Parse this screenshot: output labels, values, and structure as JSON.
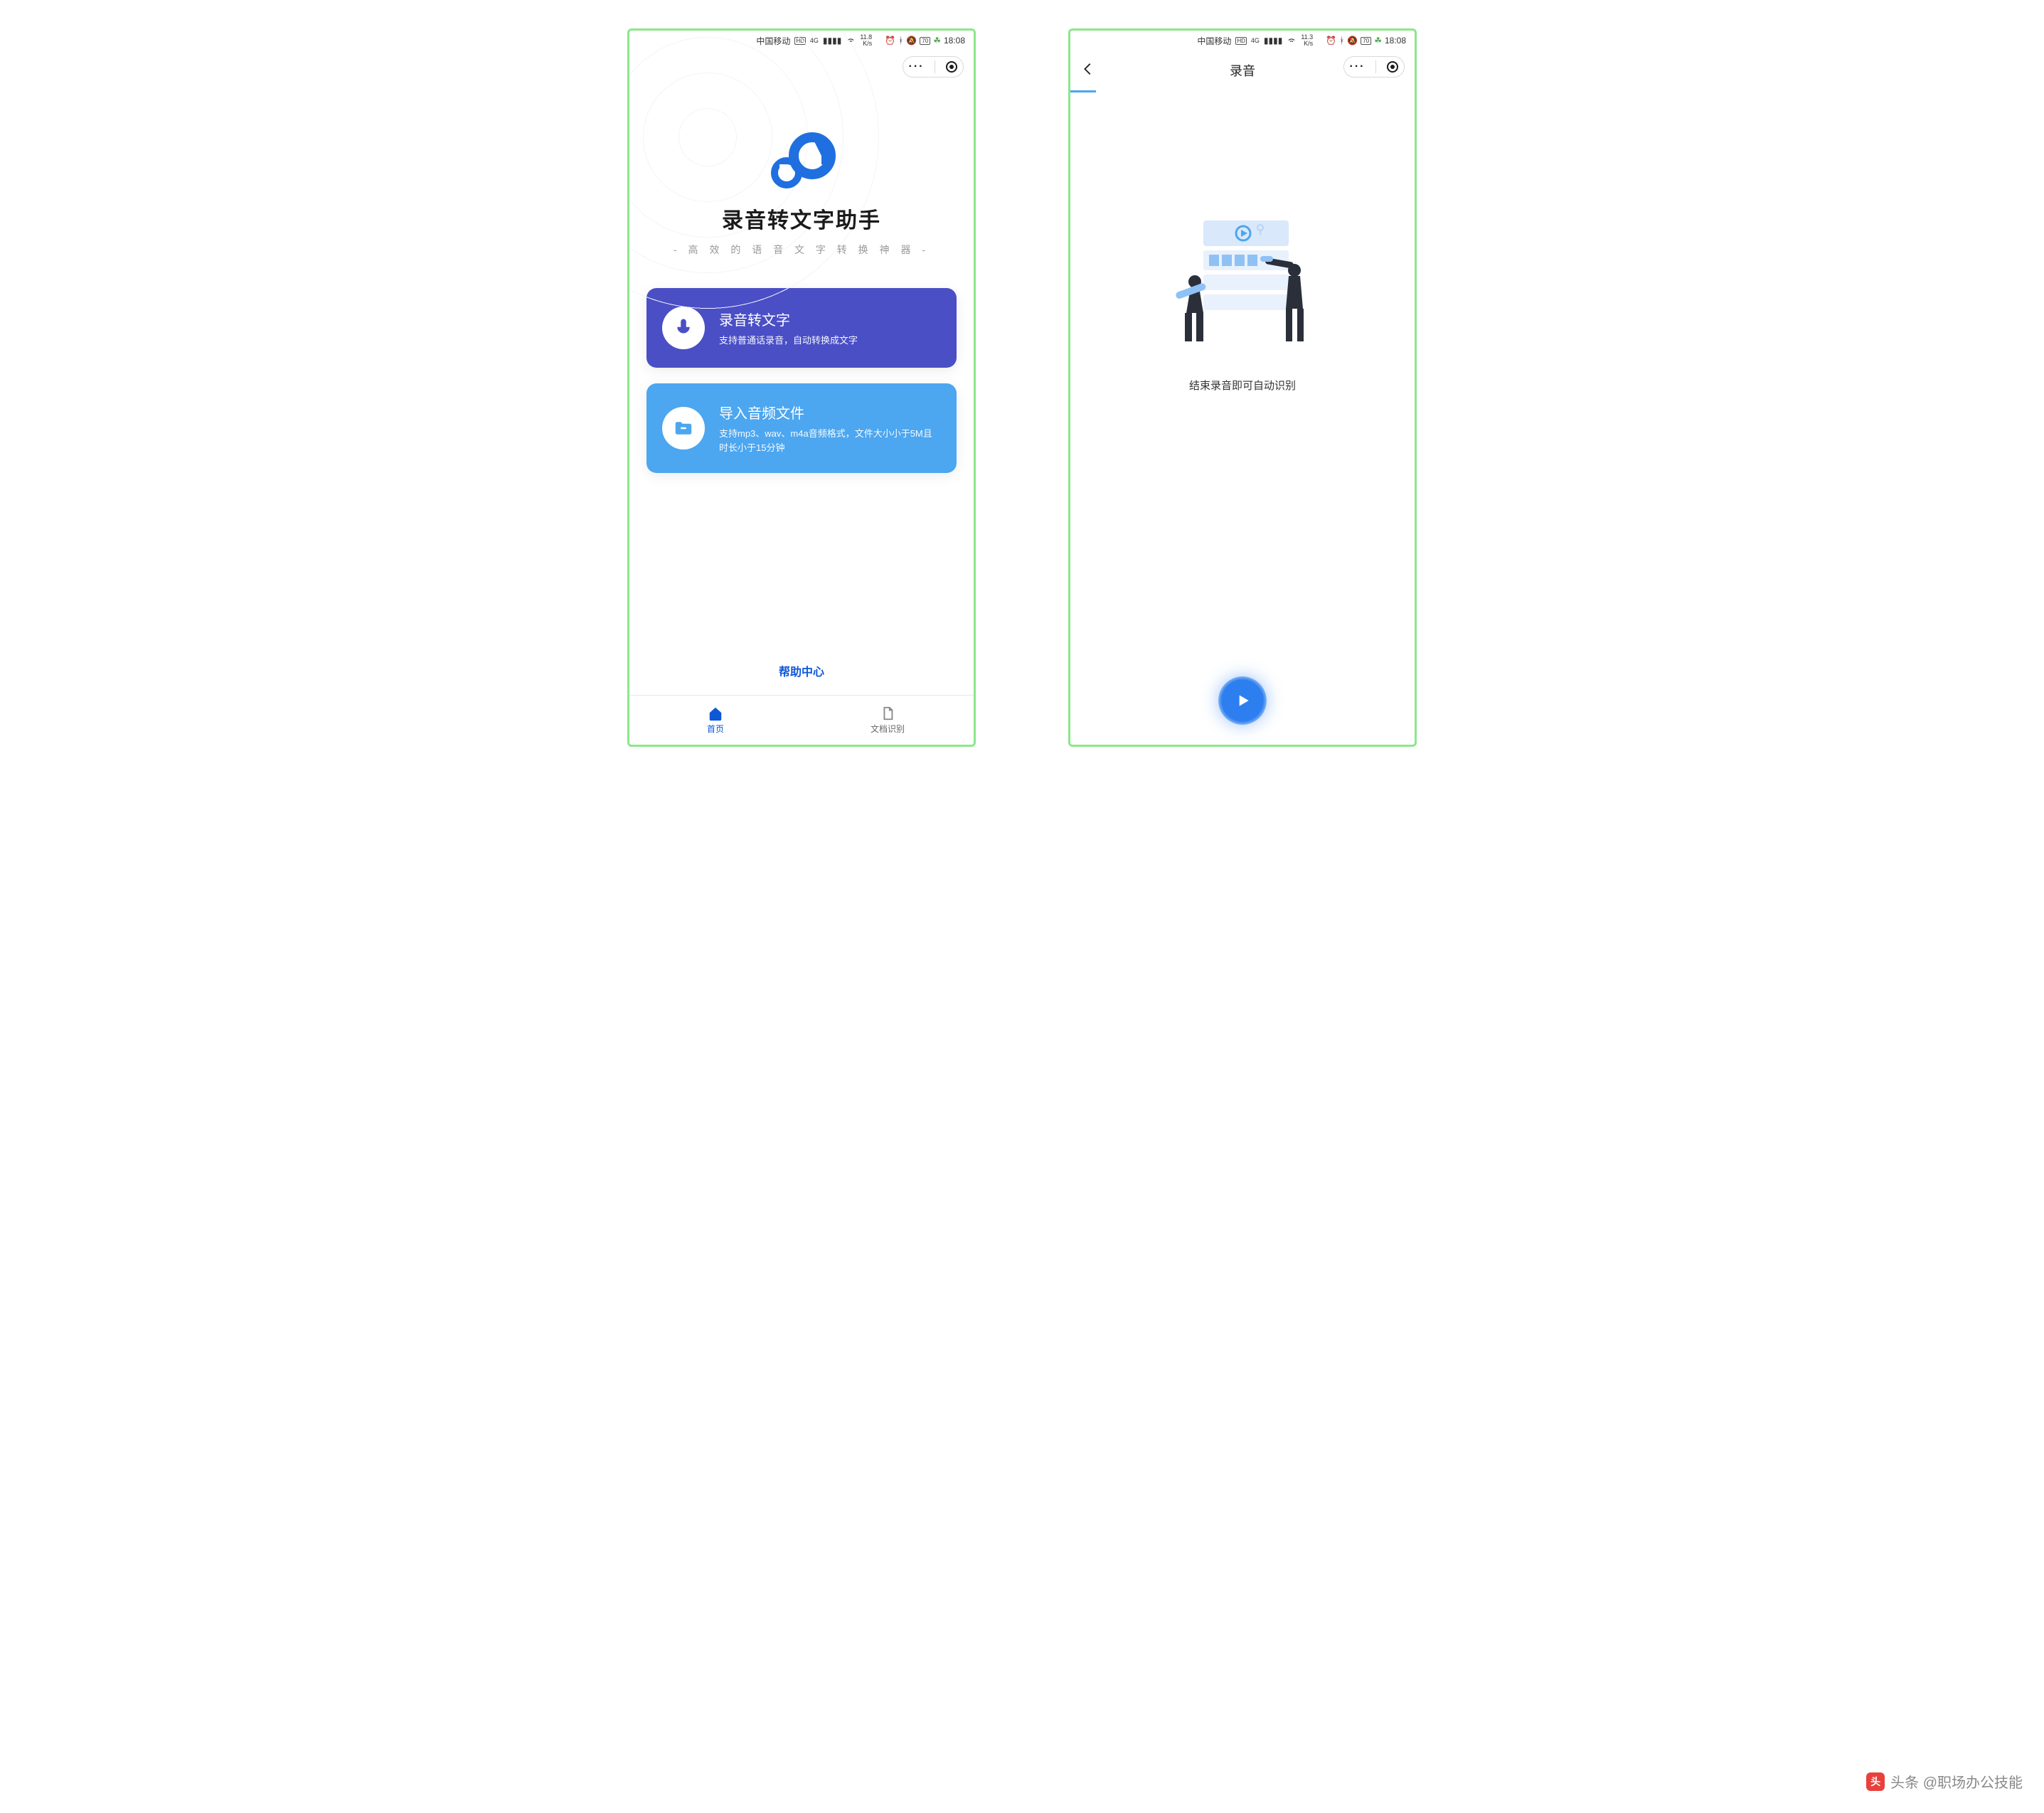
{
  "watermark_text": "头条 @职场办公技能",
  "screen1": {
    "status": {
      "carrier": "中国移动",
      "hd": "HD",
      "net": "4G",
      "speed_top": "11.8",
      "speed_bottom": "K/s",
      "battery": "70",
      "time": "18:08"
    },
    "app_title": "录音转文字助手",
    "app_subtitle": "-  高 效 的 语 音 文 字 转 换 神 器  -",
    "card1": {
      "title": "录音转文字",
      "desc": "支持普通话录音，自动转换成文字"
    },
    "card2": {
      "title": "导入音频文件",
      "desc": "支持mp3、wav、m4a音频格式，文件大小小于5M且时长小于15分钟"
    },
    "help_link": "帮助中心",
    "nav": {
      "home": "首页",
      "doc": "文档识别"
    }
  },
  "screen2": {
    "status": {
      "carrier": "中国移动",
      "hd": "HD",
      "net": "4G",
      "speed_top": "11.3",
      "speed_bottom": "K/s",
      "battery": "70",
      "time": "18:08"
    },
    "title": "录音",
    "hint": "结束录音即可自动识别"
  }
}
